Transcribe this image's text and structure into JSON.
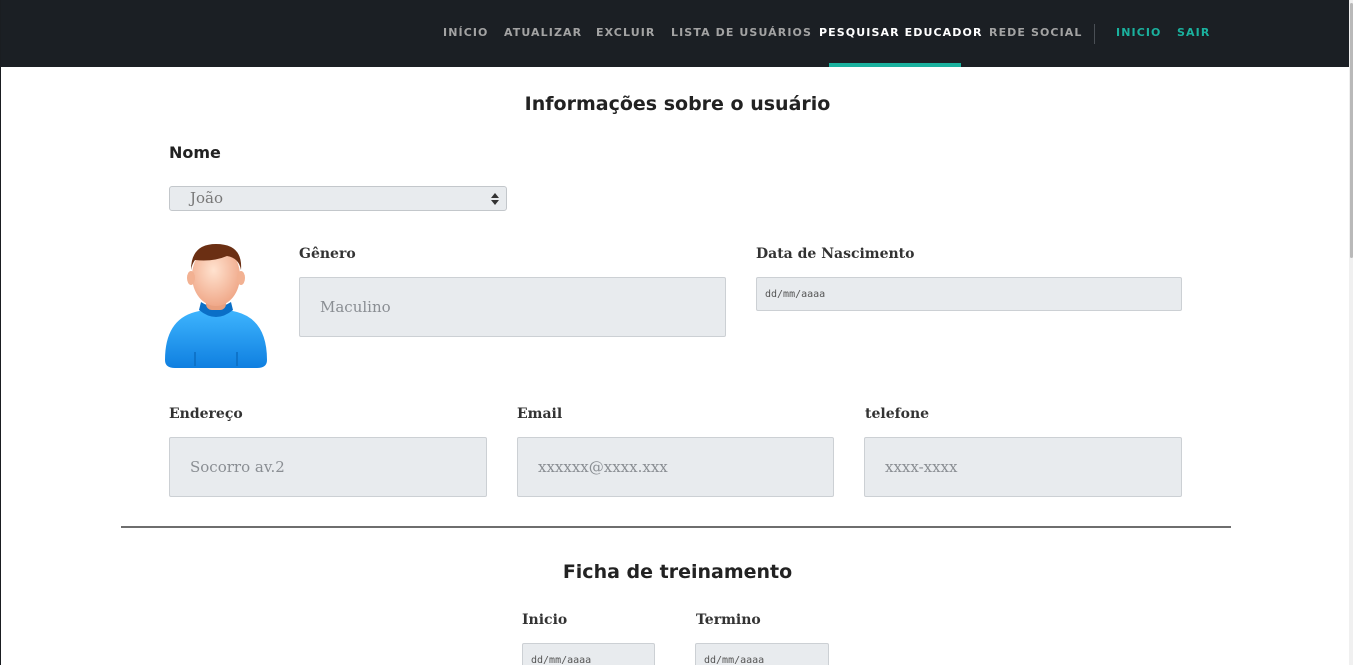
{
  "nav": {
    "items": [
      "INÍCIO",
      "ATUALIZAR",
      "EXCLUIR",
      "LISTA DE USUÁRIOS",
      "PESQUISAR EDUCADOR",
      "REDE SOCIAL"
    ],
    "active": "PESQUISAR EDUCADOR",
    "right_items": [
      "INICIO",
      "SAIR"
    ]
  },
  "user_section": {
    "title": "Informações sobre o usuário",
    "name_label": "Nome",
    "name_selected": "João",
    "gender_label": "Gênero",
    "gender_placeholder": "Maculino",
    "birth_label": "Data de Nascimento",
    "birth_placeholder": "dd/mm/aaaa",
    "address_label": "Endereço",
    "address_placeholder": "Socorro av.2",
    "email_label": "Email",
    "email_placeholder": "xxxxxx@xxxx.xxx",
    "phone_label": "telefone",
    "phone_placeholder": "xxxx-xxxx"
  },
  "training_section": {
    "title": "Ficha de treinamento",
    "start_label": "Inicio",
    "start_placeholder": "dd/mm/aaaa",
    "end_label": "Termino",
    "end_placeholder": "dd/mm/aaaa"
  },
  "colors": {
    "navbar_bg": "#1b1f24",
    "accent": "#1ab19e",
    "field_bg": "#e8ebee"
  },
  "icons": {
    "avatar": "user-avatar-icon",
    "select": "select-arrows-icon"
  }
}
